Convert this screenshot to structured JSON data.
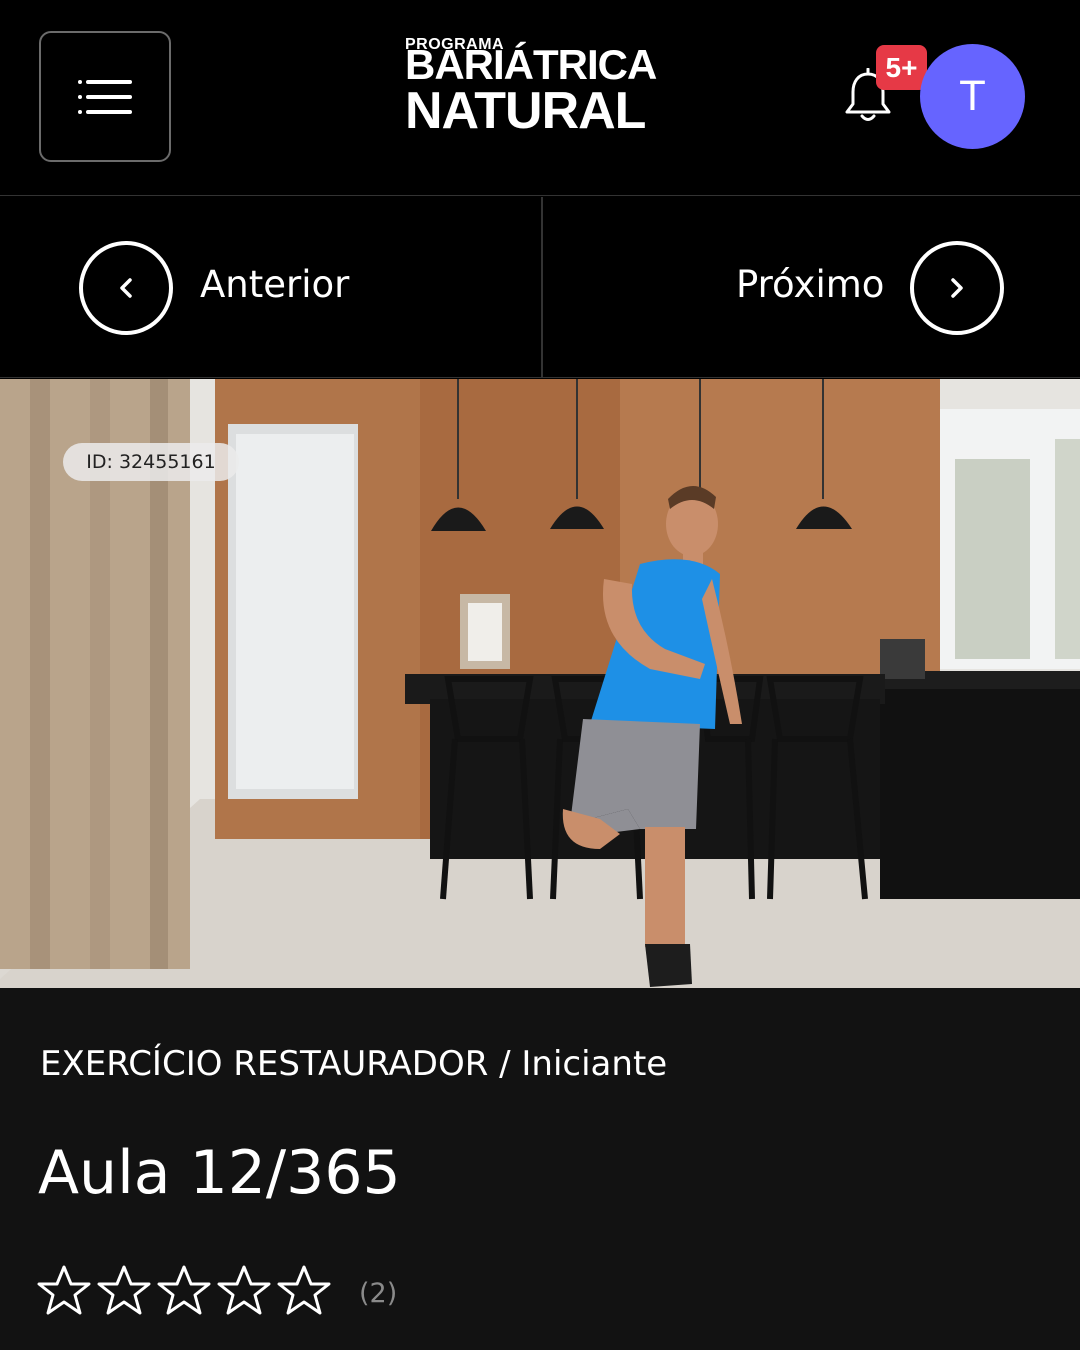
{
  "header": {
    "logo": {
      "small": "PROGRAMA",
      "line1": "BARIÁTRICA",
      "line2": "NATURAL"
    },
    "notifications_badge": "5+",
    "avatar_initial": "T",
    "icons": {
      "menu": "menu-icon",
      "bell": "bell-icon"
    }
  },
  "nav": {
    "prev_label": "Anterior",
    "next_label": "Próximo",
    "icons": {
      "prev": "chevron-left-icon",
      "next": "chevron-right-icon"
    }
  },
  "video": {
    "id_tag": "ID: 32455161"
  },
  "lesson": {
    "category": "EXERCÍCIO RESTAURADOR / Iniciante",
    "title": "Aula 12/365",
    "rating": 0,
    "rating_max": 5,
    "rating_count": "(2)"
  },
  "colors": {
    "background": "#000000",
    "info_background": "#121212",
    "badge": "#e63946",
    "avatar": "#6664ff"
  }
}
